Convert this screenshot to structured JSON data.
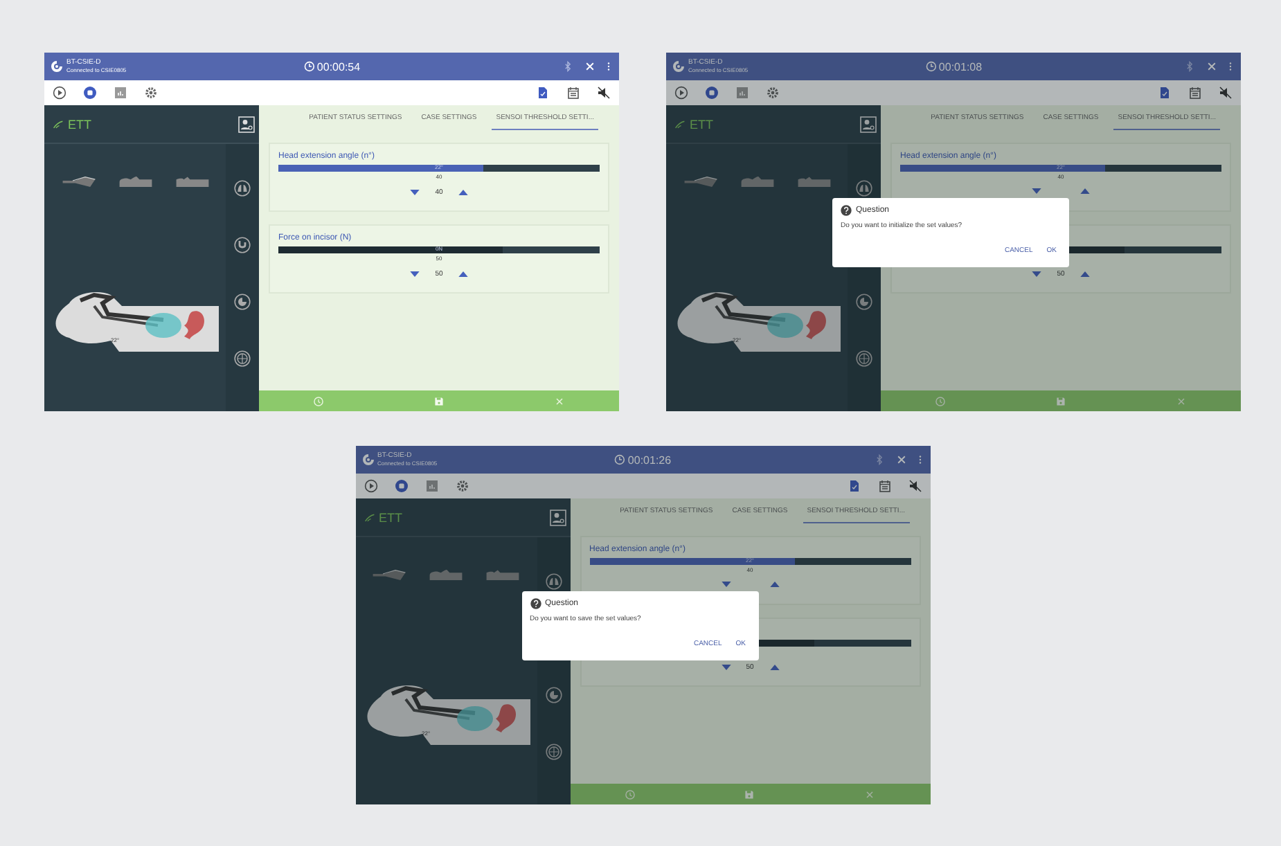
{
  "screens": [
    {
      "app": {
        "name": "BT-CSIE-D",
        "connection": "Connected to CSIE0805"
      },
      "timer": "00:00:54",
      "panel": {
        "title": "ETT",
        "angle": "22°"
      },
      "tabs": [
        {
          "label": "PATIENT STATUS SETTINGS",
          "selected": false
        },
        {
          "label": "CASE SETTINGS",
          "selected": false
        },
        {
          "label": "SENSOI THRESHOLD SETTI...",
          "selected": true
        }
      ],
      "cards": [
        {
          "kind": "angle",
          "title": "Head extension angle (n°)",
          "level": 0.64,
          "reading": "22°",
          "tick": "40",
          "value": "40"
        },
        {
          "kind": "force",
          "title": "Force on incisor (N)",
          "level": 0.7,
          "reading": "0N",
          "tick": "50",
          "value": "50"
        }
      ]
    },
    {
      "app": {
        "name": "BT-CSIE-D",
        "connection": "Connected to CSIE0805"
      },
      "timer": "00:01:08",
      "panel": {
        "title": "ETT",
        "angle": "22°"
      },
      "tabs": [
        {
          "label": "PATIENT STATUS SETTINGS",
          "selected": false
        },
        {
          "label": "CASE SETTINGS",
          "selected": false
        },
        {
          "label": "SENSOI THRESHOLD SETTI...",
          "selected": true
        }
      ],
      "cards": [
        {
          "kind": "angle",
          "title": "Head extension angle (n°)",
          "level": 0.64,
          "reading": "22°",
          "tick": "40"
        },
        {
          "kind": "force",
          "level": 0.7,
          "value": "50"
        }
      ],
      "dialog": {
        "title": "Question",
        "message": "Do you want to initialize the set values?",
        "buttons": [
          "CANCEL",
          "OK"
        ]
      }
    },
    {
      "app": {
        "name": "BT-CSIE-D",
        "connection": "Connected to CSIE0805"
      },
      "timer": "00:01:26",
      "panel": {
        "title": "ETT",
        "angle": "22°"
      },
      "tabs": [
        {
          "label": "PATIENT STATUS SETTINGS",
          "selected": false
        },
        {
          "label": "CASE SETTINGS",
          "selected": false
        },
        {
          "label": "SENSOI THRESHOLD SETTI...",
          "selected": true
        }
      ],
      "cards": [
        {
          "kind": "angle",
          "title": "Head extension angle (n°)",
          "level": 0.64,
          "reading": "22°",
          "tick": "40"
        },
        {
          "kind": "force",
          "level": 0.7,
          "value": "50"
        }
      ],
      "dialog": {
        "title": "Question",
        "message": "Do you want to save the set values?",
        "buttons": [
          "CANCEL",
          "OK"
        ]
      }
    }
  ]
}
